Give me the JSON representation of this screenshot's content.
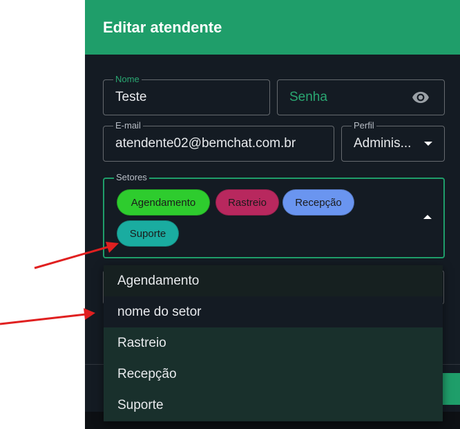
{
  "dialog": {
    "title": "Editar atendente"
  },
  "form": {
    "nome": {
      "label": "Nome",
      "value": "Teste"
    },
    "senha": {
      "placeholder": "Senha"
    },
    "email": {
      "label": "E-mail",
      "value": "atendente02@bemchat.com.br"
    },
    "perfil": {
      "label": "Perfil",
      "value": "Adminis..."
    },
    "setores": {
      "label": "Setores",
      "chips": [
        {
          "label": "Agendamento",
          "color": "#2ecc2e"
        },
        {
          "label": "Rastreio",
          "color": "#b8285e"
        },
        {
          "label": "Recepção",
          "color": "#6a95f0"
        },
        {
          "label": "Suporte",
          "color": "#1aaca0"
        }
      ]
    }
  },
  "dropdown": {
    "options": [
      "Agendamento",
      "nome do setor",
      "Rastreio",
      "Recepção",
      "Suporte"
    ]
  },
  "colors": {
    "accent": "#1f9e6a",
    "background": "#141b23",
    "annotation_arrow": "#e02020"
  }
}
